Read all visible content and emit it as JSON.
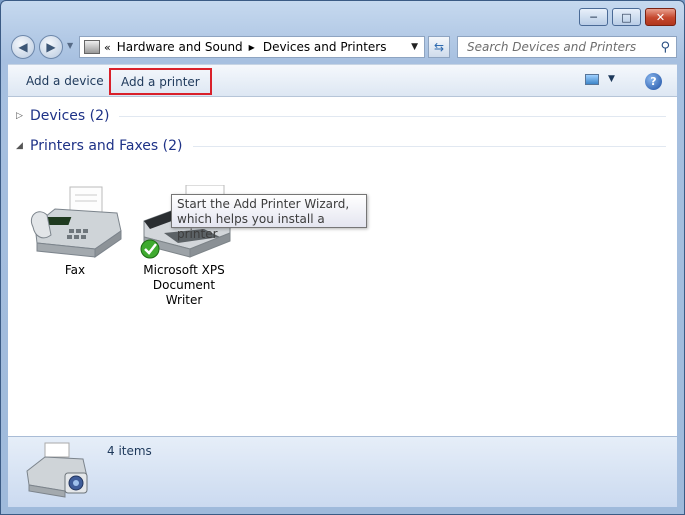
{
  "window": {
    "minimize_label": "─",
    "maximize_label": "□",
    "close_label": "✕"
  },
  "address": {
    "segments": [
      "Hardware and Sound",
      "Devices and Printers"
    ]
  },
  "search": {
    "placeholder": "Search Devices and Printers"
  },
  "toolbar": {
    "add_device_label": "Add a device",
    "add_printer_label": "Add a printer"
  },
  "tooltip": {
    "text": "Start the Add Printer Wizard, which helps you install a printer"
  },
  "groups": [
    {
      "label": "Devices (2)"
    },
    {
      "label": "Printers and Faxes (2)"
    }
  ],
  "items": [
    {
      "label": "Fax"
    },
    {
      "label": "Microsoft XPS Document Writer"
    }
  ],
  "details": {
    "count": "4 items"
  }
}
